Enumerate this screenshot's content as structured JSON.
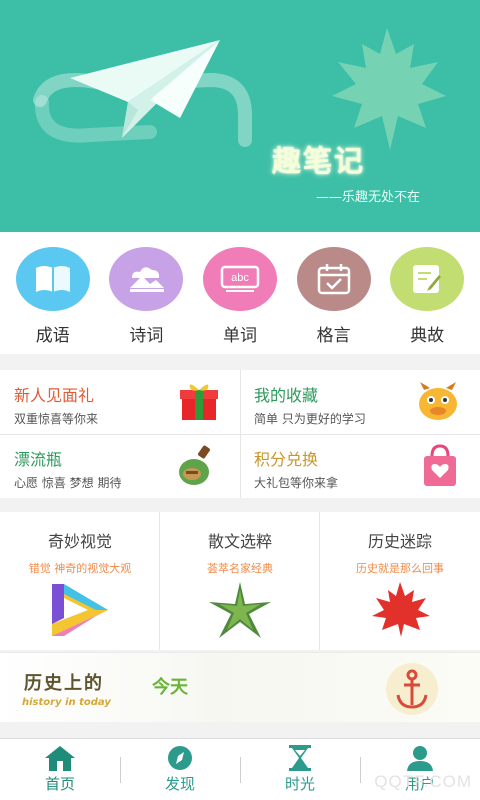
{
  "banner": {
    "title": "趣笔记",
    "slogan": "——乐趣无处不在",
    "colors": {
      "background": "#3cbfa6",
      "title": "#f4ffd9"
    },
    "icons": [
      "paper-plane-icon",
      "maple-leaf-icon"
    ]
  },
  "categories": [
    {
      "label": "成语",
      "color": "#5ac8f0",
      "icon": "book-icon"
    },
    {
      "label": "诗词",
      "color": "#c8a2e6",
      "icon": "mountain-cloud-icon"
    },
    {
      "label": "单词",
      "color": "#f07cb8",
      "icon": "abc-icon"
    },
    {
      "label": "格言",
      "color": "#b98a88",
      "icon": "calendar-check-icon"
    },
    {
      "label": "典故",
      "color": "#c2dd72",
      "icon": "note-edit-icon"
    }
  ],
  "promo": [
    {
      "title": "新人见面礼",
      "subtitle": "双重惊喜等你来",
      "color": "#e05b36",
      "icon": "gift-icon"
    },
    {
      "title": "我的收藏",
      "subtitle": "简单 只为更好的学习",
      "color": "#2c9a5a",
      "icon": "cartoon-face-icon"
    },
    {
      "title": "漂流瓶",
      "subtitle": "心愿 惊喜 梦想 期待",
      "color": "#2c9a5a",
      "icon": "bottle-icon"
    },
    {
      "title": "积分兑换",
      "subtitle": "大礼包等你来拿",
      "color": "#c8962a",
      "icon": "shopping-bag-icon"
    }
  ],
  "features": [
    {
      "title": "奇妙视觉",
      "subtitle": "错觉 神奇的视觉大观",
      "icon": "impossible-triangle-icon"
    },
    {
      "title": "散文选粹",
      "subtitle": "荟萃名家经典",
      "icon": "starfish-icon"
    },
    {
      "title": "历史迷踪",
      "subtitle": "历史就是那么回事",
      "icon": "maple-leaf-icon"
    }
  ],
  "history": {
    "title": "历史上的",
    "subtitle": "history in today",
    "highlight": "今天",
    "icon": "anchor-icon"
  },
  "nav": [
    {
      "label": "首页",
      "icon": "home-icon",
      "active": true
    },
    {
      "label": "发现",
      "icon": "compass-icon",
      "active": false
    },
    {
      "label": "时光",
      "icon": "hourglass-icon",
      "active": false
    },
    {
      "label": "用户",
      "icon": "user-icon",
      "active": false
    }
  ],
  "watermark": "QQTF.COM"
}
